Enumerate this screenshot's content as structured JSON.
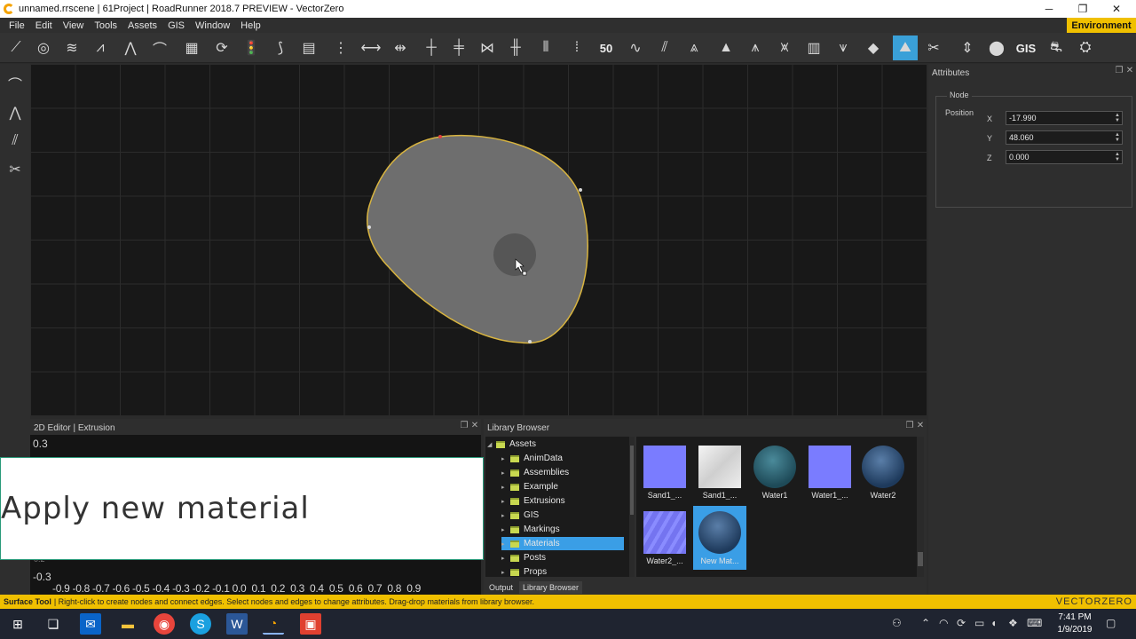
{
  "window": {
    "title": "unnamed.rrscene | 61Project | RoadRunner 2018.7 PREVIEW - VectorZero",
    "min_glyph": "─",
    "restore_glyph": "❐",
    "close_glyph": "✕"
  },
  "menu": {
    "items": [
      "File",
      "Edit",
      "View",
      "Tools",
      "Assets",
      "GIS",
      "Window",
      "Help"
    ],
    "environment_label": "Environment"
  },
  "toolbar": {
    "speed_label": "50",
    "gis_label": "GIS"
  },
  "attributes": {
    "title": "Attributes",
    "group_label": "Node",
    "position_label": "Position",
    "x_label": "X",
    "y_label": "Y",
    "z_label": "Z",
    "x_value": "-17.990",
    "y_value": "48.060",
    "z_value": "0.000"
  },
  "editor2d": {
    "title": "2D Editor | Extrusion",
    "y_top": "0.3",
    "y_bottom": "-0.3",
    "y_partial": "0.2",
    "x_ticks": "-0.9 -0.8 -0.7 -0.6 -0.5 -0.4 -0.3 -0.2 -0.1 0.0  0.1  0.2  0.3  0.4  0.5  0.6  0.7  0.8  0.9"
  },
  "caption": {
    "text": "Apply new material"
  },
  "library": {
    "title": "Library Browser",
    "tree": [
      {
        "label": "Assets",
        "level": 0
      },
      {
        "label": "AnimData",
        "level": 1
      },
      {
        "label": "Assemblies",
        "level": 1
      },
      {
        "label": "Example",
        "level": 1
      },
      {
        "label": "Extrusions",
        "level": 1
      },
      {
        "label": "GIS",
        "level": 1
      },
      {
        "label": "Markings",
        "level": 1
      },
      {
        "label": "Materials",
        "level": 1,
        "selected": true
      },
      {
        "label": "Posts",
        "level": 1
      },
      {
        "label": "Props",
        "level": 1
      }
    ],
    "thumbnails": [
      {
        "label": "Sand1_...",
        "kind": "blue-square"
      },
      {
        "label": "Sand1_...",
        "kind": "white-square"
      },
      {
        "label": "Water1",
        "kind": "teal-sphere"
      },
      {
        "label": "Water1_...",
        "kind": "blue-square"
      },
      {
        "label": "Water2",
        "kind": "blue-sphere"
      },
      {
        "label": "Water2_...",
        "kind": "blue-textured"
      },
      {
        "label": "New Mat...",
        "kind": "blue-sphere",
        "selected": true
      }
    ],
    "tabs": [
      "Output",
      "Library Browser"
    ]
  },
  "status": {
    "tool_name": "Surface Tool",
    "message": "| Right-click to create nodes and connect edges. Select nodes and edges to change attributes. Drag-drop materials from library browser.",
    "brand": "VECTORZERO"
  },
  "taskbar": {
    "time": "7:41 PM",
    "date": "1/9/2019"
  },
  "colors": {
    "accent_yellow": "#f0c000",
    "selection_blue": "#3a9ee6",
    "surface_fill": "#6e6e6e",
    "surface_outline": "#d8b440"
  }
}
